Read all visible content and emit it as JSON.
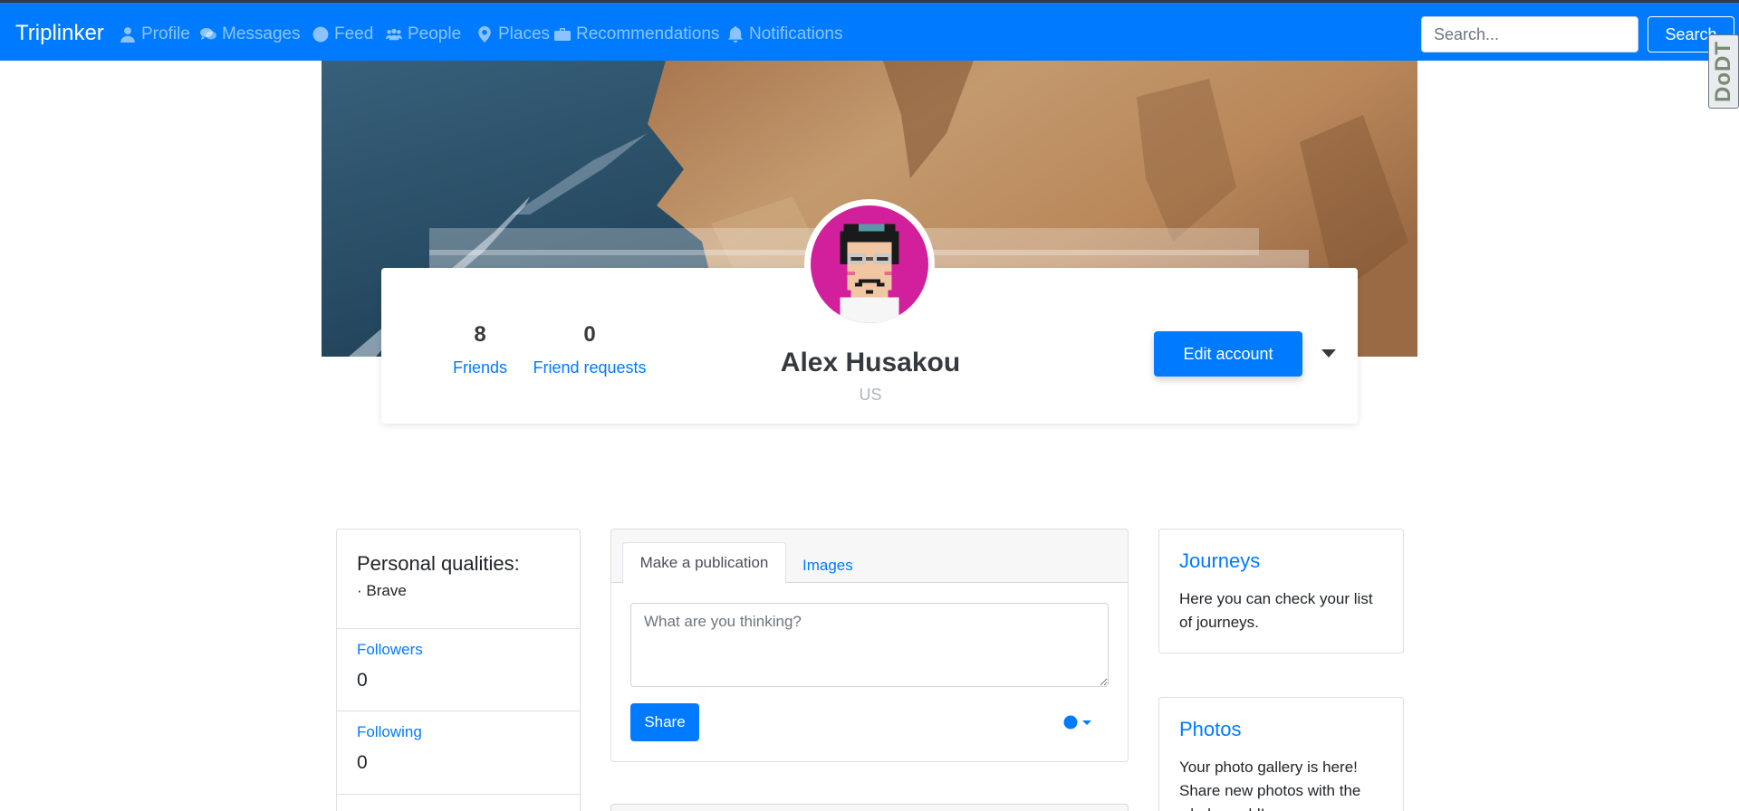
{
  "navbar": {
    "brand": "Triplinker",
    "items": [
      {
        "label": "Profile",
        "icon": "user-icon"
      },
      {
        "label": "Messages",
        "icon": "comments-icon"
      },
      {
        "label": "Feed",
        "icon": "globe-icon"
      },
      {
        "label": "People",
        "icon": "users-icon"
      },
      {
        "label": "Places",
        "icon": "map-marker-icon"
      },
      {
        "label": "Recommendations",
        "icon": "suitcase-icon"
      },
      {
        "label": "Notifications",
        "icon": "bell-icon"
      }
    ],
    "search_placeholder": "Search...",
    "search_button": "Search"
  },
  "extension_badge": "DoDT",
  "profile": {
    "friends_count": "8",
    "friends_label": "Friends",
    "requests_count": "0",
    "requests_label": "Friend requests",
    "name": "Alex Husakou",
    "country": "US",
    "edit_button": "Edit account"
  },
  "left_panel": {
    "qualities_title": "Personal qualities:",
    "quality": "· Brave",
    "followers_label": "Followers",
    "followers_count": "0",
    "following_label": "Following",
    "following_count": "0"
  },
  "publication": {
    "tab_active": "Make a publication",
    "tab_images": "Images",
    "placeholder": "What are you thinking?",
    "share_button": "Share"
  },
  "journeys": {
    "title": "Journeys",
    "text": "Here you can check your list of journeys."
  },
  "photos": {
    "title": "Photos",
    "text": "Your photo gallery is here! Share new photos with the whole world!"
  },
  "colors": {
    "primary": "#007bff",
    "avatar_bg": "#d21f9b"
  }
}
